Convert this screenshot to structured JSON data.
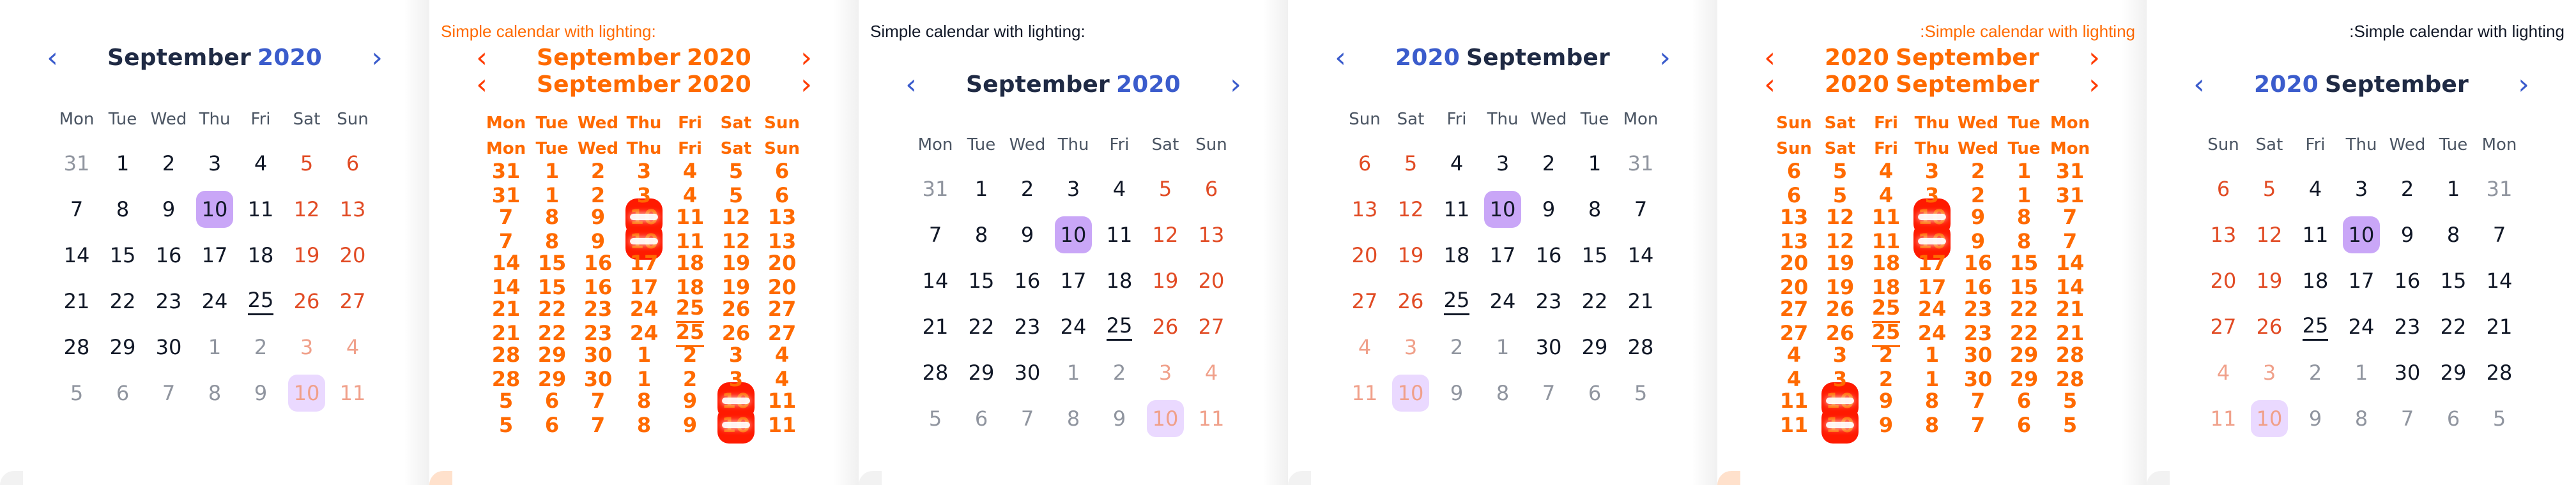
{
  "captions": {
    "c1": "",
    "c2": "Simple calendar with lighting:",
    "c3": "Simple calendar with lighting:",
    "c4": "",
    "c5": ":Simple calendar with lighting",
    "c6": ":Simple calendar with lighting"
  },
  "calendar": {
    "month": "September",
    "year": "2020",
    "weekdays_ltr": [
      "Mon",
      "Tue",
      "Wed",
      "Thu",
      "Fri",
      "Sat",
      "Sun"
    ],
    "weekdays_rtl": [
      "Sun",
      "Sat",
      "Fri",
      "Thu",
      "Wed",
      "Tue",
      "Mon"
    ],
    "weeks_ltr": [
      [
        "31",
        "1",
        "2",
        "3",
        "4",
        "5",
        "6"
      ],
      [
        "7",
        "8",
        "9",
        "10",
        "11",
        "12",
        "13"
      ],
      [
        "14",
        "15",
        "16",
        "17",
        "18",
        "19",
        "20"
      ],
      [
        "21",
        "22",
        "23",
        "24",
        "25",
        "26",
        "27"
      ],
      [
        "28",
        "29",
        "30",
        "1",
        "2",
        "3",
        "4"
      ],
      [
        "5",
        "6",
        "7",
        "8",
        "9",
        "10",
        "11"
      ]
    ],
    "weeks_rtl": [
      [
        "6",
        "5",
        "4",
        "3",
        "2",
        "1",
        "31"
      ],
      [
        "13",
        "12",
        "11",
        "10",
        "9",
        "8",
        "7"
      ],
      [
        "20",
        "19",
        "18",
        "17",
        "16",
        "15",
        "14"
      ],
      [
        "27",
        "26",
        "25",
        "24",
        "23",
        "22",
        "21"
      ],
      [
        "4",
        "3",
        "2",
        "1",
        "30",
        "29",
        "28"
      ],
      [
        "11",
        "10",
        "9",
        "8",
        "7",
        "6",
        "5"
      ]
    ]
  },
  "icons": {
    "prev": "chevron-left-icon",
    "next": "chevron-right-icon"
  },
  "colors": {
    "accent": "#3b5ccc",
    "selected": "#c9a6f7",
    "selected_light": "#ead9ff",
    "weekend": "#e14b24",
    "glitch": "#ff6a00",
    "glitch_red": "#ff1a00"
  }
}
